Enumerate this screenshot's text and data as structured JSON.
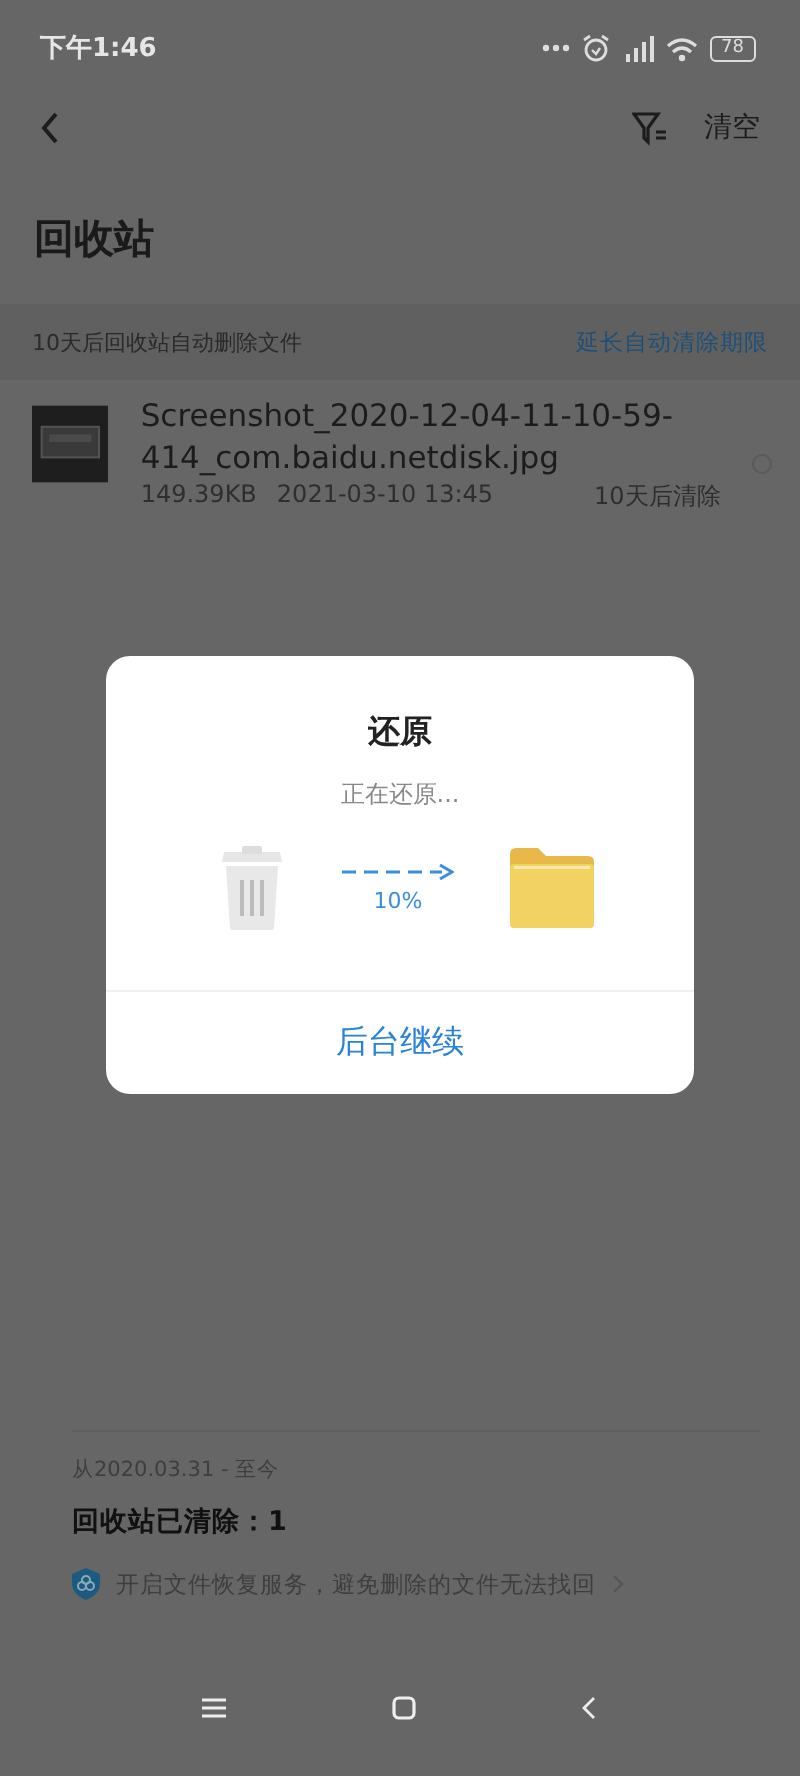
{
  "status_bar": {
    "time": "下午1:46",
    "battery": "78"
  },
  "toolbar": {
    "action": "清空"
  },
  "title": "回收站",
  "banner": {
    "text": "10天后回收站自动删除文件",
    "link": "延长自动清除期限"
  },
  "files": [
    {
      "name": "Screenshot_2020-12-04-11-10-59-414_com.baidu.netdisk.jpg",
      "size": "149.39KB",
      "date": "2021-03-10  13:45",
      "expiry": "10天后清除",
      "selected": false
    }
  ],
  "dialog": {
    "title": "还原",
    "message": "正在还原...",
    "progress": "10%",
    "button": "后台继续"
  },
  "footer": {
    "period": "从2020.03.31 - 至今",
    "count": "回收站已清除：1",
    "promo": "开启文件恢复服务，避免删除的文件无法找回"
  }
}
